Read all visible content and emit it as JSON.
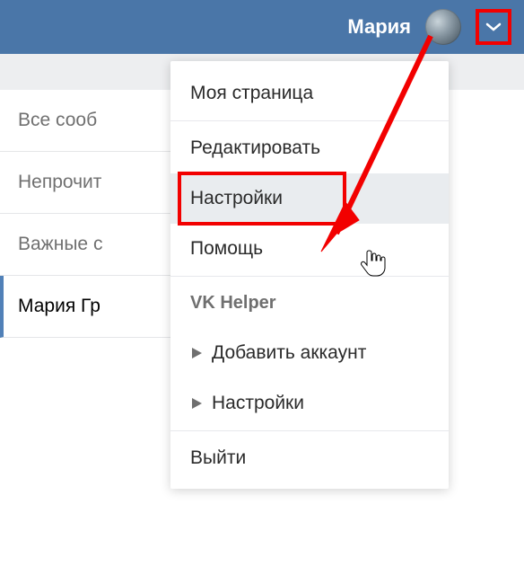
{
  "header": {
    "username": "Мария"
  },
  "sidebar": {
    "items": [
      "Все сооб",
      "Непрочит",
      "Важные с",
      "Мария Гр"
    ]
  },
  "dropdown": {
    "my_page": "Моя страница",
    "edit": "Редактировать",
    "settings": "Настройки",
    "help": "Помощь",
    "vk_helper_section": "VK Helper",
    "add_account": "Добавить аккаунт",
    "vk_settings": "Настройки",
    "logout": "Выйти"
  }
}
